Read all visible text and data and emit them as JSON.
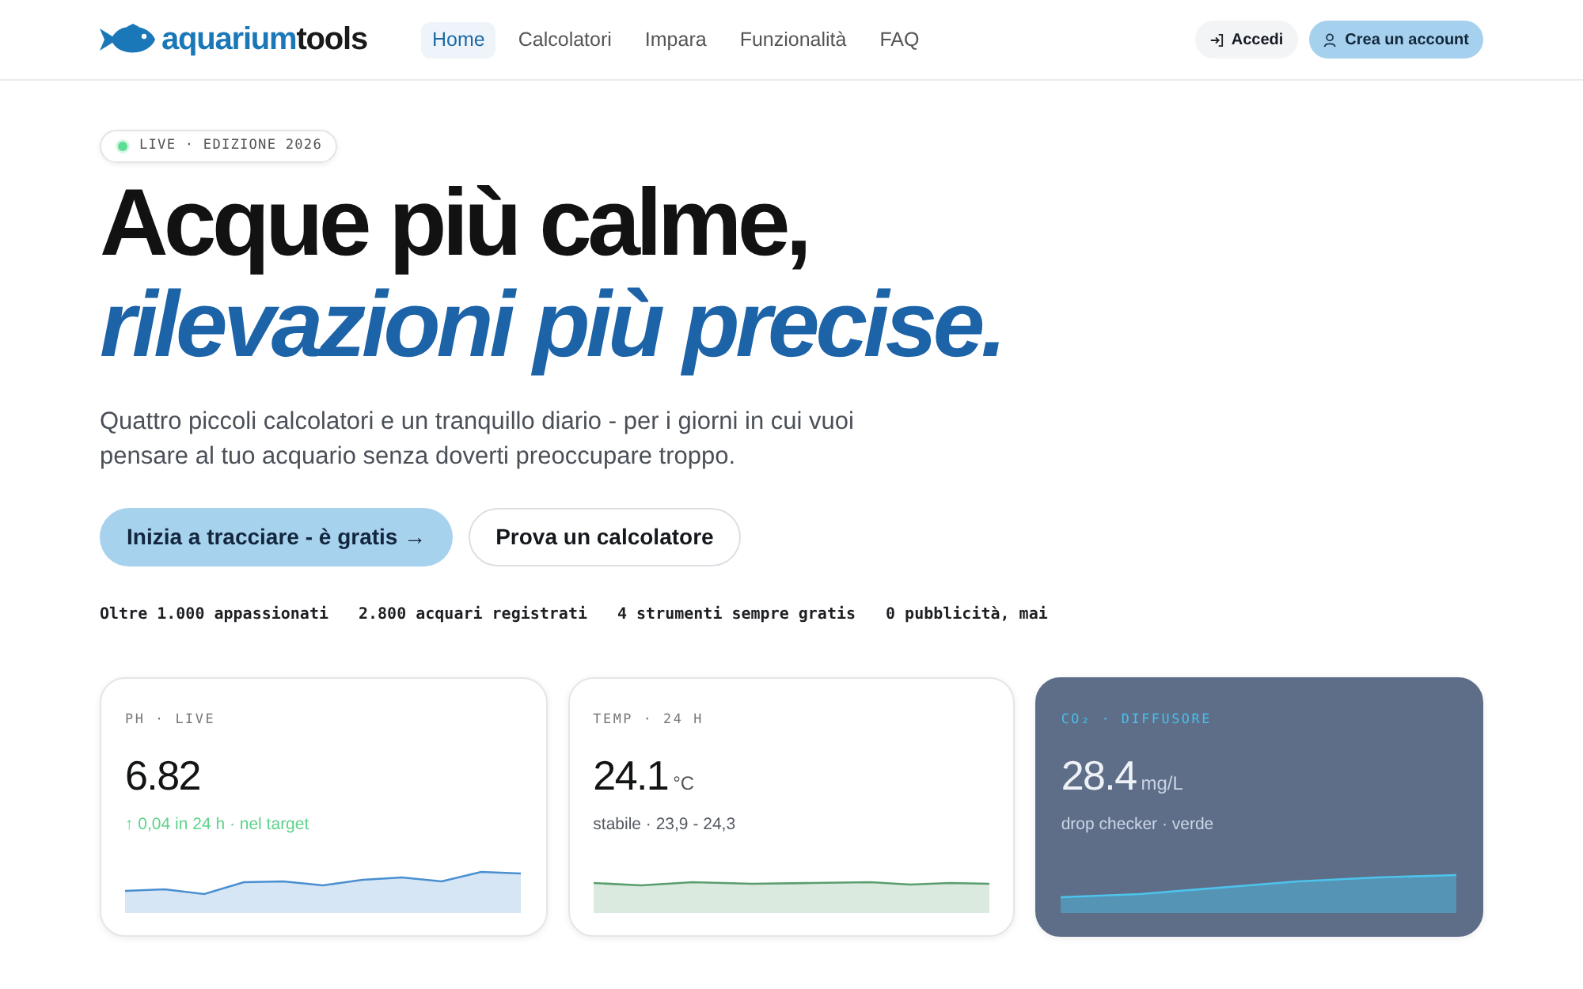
{
  "brand": {
    "prefix": "aquarium",
    "suffix": "tools"
  },
  "nav": [
    {
      "label": "Home",
      "selected": true
    },
    {
      "label": "Calcolatori",
      "selected": false
    },
    {
      "label": "Impara",
      "selected": false
    },
    {
      "label": "Funzionalità",
      "selected": false
    },
    {
      "label": "FAQ",
      "selected": false
    }
  ],
  "account_actions": [
    {
      "label": "Accedi",
      "kind": "login"
    },
    {
      "label": "Crea un account",
      "kind": "signup"
    }
  ],
  "hero": {
    "badge": {
      "label": "LIVE · EDIZIONE 2026",
      "live": true
    },
    "headline": "Acque più calme,",
    "headline_accent": "rilevazioni più precise.",
    "intro": "Quattro piccoli calcolatori e un tranquillo diario - per i giorni in cui vuoi pensare al tuo acquario senza doverti preoccupare troppo.",
    "buttons": [
      {
        "label": "Inizia a tracciare - è gratis →",
        "kind": "primary"
      },
      {
        "label": "Prova un calcolatore",
        "kind": "secondary"
      }
    ],
    "stats": [
      "Oltre 1.000 appassionati",
      "2.800 acquari registrati",
      "4 strumenti sempre gratis",
      "0 pubblicità, mai"
    ]
  },
  "metrics": [
    {
      "label": "PH · LIVE",
      "value": "6.82",
      "note": "↑ 0,04 in 24 h · nel target",
      "note_positive": true,
      "highlighted": false,
      "color": "#4a8fd0"
    },
    {
      "label": "TEMP · 24 H",
      "value": "24.1",
      "unit": "°C",
      "note": "stabile · 23,9 - 24,3",
      "note_positive": false,
      "highlighted": false,
      "color": "#5a9e6e"
    },
    {
      "label": "CO₂ · DIFFUSORE",
      "value": "28.4",
      "unit": "mg/L",
      "note": "drop checker · verde",
      "note_positive": false,
      "highlighted": true,
      "color": "#4cc4ec"
    }
  ]
}
